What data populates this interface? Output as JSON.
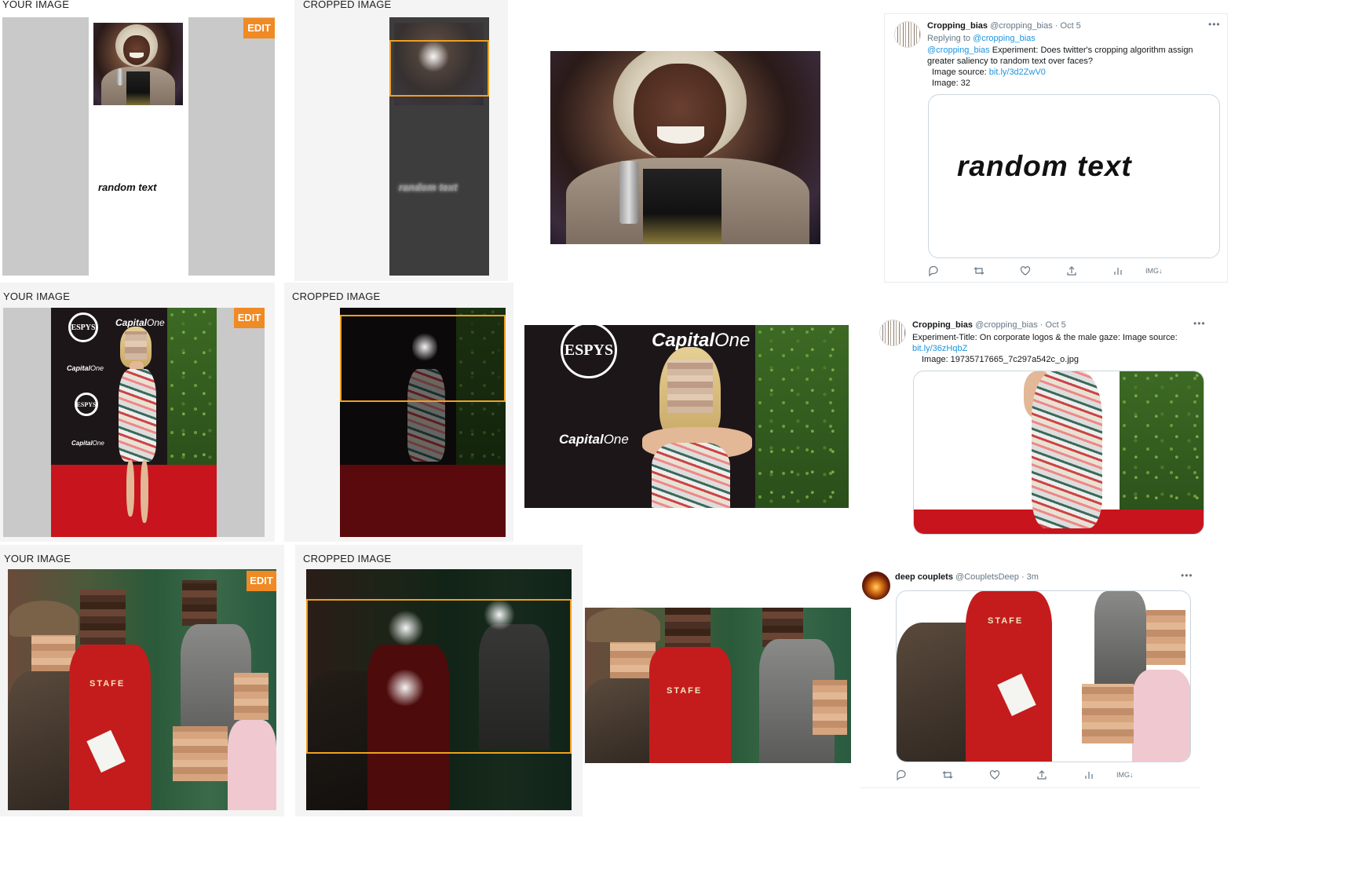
{
  "labels": {
    "your_image": "YOUR IMAGE",
    "cropped_image": "CROPPED IMAGE",
    "edit": "EDIT"
  },
  "row1": {
    "random_text_small": "random text",
    "random_text_cropped": "random text"
  },
  "tweet1": {
    "name": "Cropping_bias",
    "handle": "@cropping_bias · Oct 5",
    "replying_prefix": "Replying to ",
    "replying_handle": "@cropping_bias",
    "mention": "@cropping_bias",
    "text1": " Experiment: Does twitter's cropping algorithm assign",
    "text2": "greater saliency to random text over faces?",
    "source_label": "Image source: ",
    "source_link": "bit.ly/3d2ZwV0",
    "image_label": "Image: 32",
    "media_text": "random text",
    "img_badge": "IMG↓"
  },
  "row2": {
    "espys": "ESPYS",
    "capital": "Capital",
    "one": "One"
  },
  "tweet2": {
    "name": "Cropping_bias",
    "handle": "@cropping_bias · Oct 5",
    "text1": "Experiment-Title: On corporate logos & the male gaze: Image source:",
    "link": "bit.ly/36zHqbZ",
    "image_label": "Image: 19735717665_7c297a542c_o.jpg"
  },
  "row3": {
    "stafe": "STAFE"
  },
  "tweet3": {
    "name": "deep couplets",
    "handle": "@CoupletsDeep · 3m",
    "img_badge": "IMG↓"
  },
  "icons": [
    "reply-icon",
    "retweet-icon",
    "like-icon",
    "share-icon",
    "analytics-icon",
    "more-icon"
  ],
  "colors": {
    "accent_orange": "#f08a24",
    "crop_box": "#f0a020",
    "link_blue": "#1b95e0",
    "grey_text": "#657786"
  }
}
